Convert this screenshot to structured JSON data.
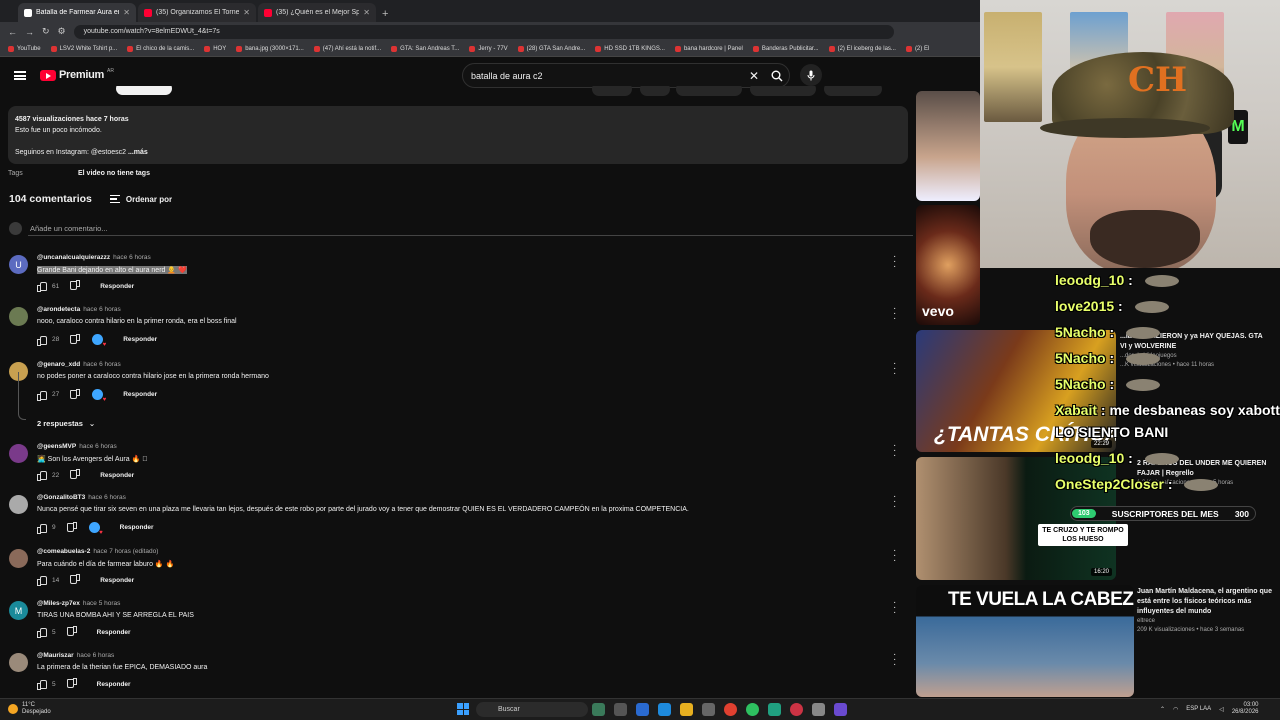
{
  "browser": {
    "tabs": [
      {
        "title": "Batalla de Farmear Aura en el..."
      },
      {
        "title": "(35) Organizamos El Torneo M..."
      },
      {
        "title": "(35) ¿Quién es el Mejor Spider..."
      }
    ],
    "url": "youtube.com/watch?v=8elmEDWUt_4&t=7s",
    "bookmarks": [
      "YouTube",
      "LSV2 White Tshirt p...",
      "El chico de la camis...",
      "HOY",
      "bana.jpg (3000×171...",
      "(47) Ahí está la notif...",
      "GTA: San Andreas T...",
      "Jerry - 77V",
      "(28) GTA San Andre...",
      "HD SSD 1TB KINGS...",
      "bana hardcore | Panel",
      "Banderas Publicitar...",
      "(2) El iceberg de las...",
      "(2) El"
    ]
  },
  "youtube": {
    "logo": "Premium",
    "logo_cc": "AR",
    "search_query": "batalla de aura c2"
  },
  "description": {
    "stats": "4587 visualizaciones  hace 7 horas",
    "line1": "Esto fue un poco incómodo.",
    "instagram": "Seguinos en Instagram: @estoesc2",
    "more": "...más"
  },
  "tags": {
    "label": "Tags",
    "value": "El video no tiene tags"
  },
  "comments": {
    "count_label": "104 comentarios",
    "sort_label": "Ordenar por",
    "add_placeholder": "Añade un comentario...",
    "reply_label": "Responder",
    "items": [
      {
        "user": "@uncanalcualquierazzz",
        "time": "hace 6 horas",
        "text": "Grande Bani dejando en alto el aura nerd 🧑‍🦲 ❤️",
        "likes": "61",
        "initial": "U",
        "color": "#5c6bc0"
      },
      {
        "user": "@arondetecta",
        "time": "hace 6 horas",
        "text": "nooo, caraloco contra hilario en la primer ronda, era el boss final",
        "likes": "28",
        "initial": "",
        "color": "#6b7a52"
      },
      {
        "user": "@genaro_xdd",
        "time": "hace 6 horas",
        "text": "no podes poner a caraloco contra hilario jose en la primera ronda hermano",
        "likes": "27",
        "initial": "",
        "color": "#c8a050"
      },
      {
        "user": "@geensMVP",
        "time": "hace 6 horas",
        "text": "🧑‍💻 Son los Avengers del Aura 🔥 🏻",
        "likes": "22",
        "initial": "",
        "color": "#7a3a8a"
      },
      {
        "user": "@GonzalitoBT3",
        "time": "hace 6 horas",
        "text": "Nunca pensé que tirar six seven en una plaza me llevaria tan lejos, después de este robo por parte del jurado voy a tener que demostrar QUIEN ES EL VERDADERO CAMPEÓN en la proxima COMPETENCIA.",
        "likes": "9",
        "initial": "",
        "color": "#aaa"
      },
      {
        "user": "@comeabuelas-2",
        "time": "hace 7 horas (editado)",
        "text": "Para cuándo el día de farmear laburo 🔥 🔥",
        "likes": "14",
        "initial": "",
        "color": "#8a6a5a"
      },
      {
        "user": "@Miles-zp7ex",
        "time": "hace 5 horas",
        "text": "TIRAS UNA BOMBA AHI Y SE ARREGLA EL PAIS",
        "likes": "5",
        "initial": "M",
        "color": "#1a8a9a"
      },
      {
        "user": "@Mauriszar",
        "time": "hace 6 horas",
        "text": "La primera de la therian fue EPICA, DEMASIADO aura",
        "likes": "5",
        "initial": "",
        "color": "#9a8a7a"
      }
    ],
    "replies_label": "2 respuestas"
  },
  "recommendations": {
    "vevo": "vevo",
    "critics_title": "¿TANTAS CRÍTICAS",
    "r3_title": "...ía NO SALIERON y ya HAY QUEJAS. GTA VI y WOLVERINE",
    "r3_channel": "...dor de Videojuegos",
    "r3_stats": "...K visualizaciones • hace 11 horas",
    "r3_duration": "22:29",
    "r4_title": "2 RAPEROS DEL UNDER ME QUIEREN FAJAR | Regrello",
    "r4_stats": "1,3 K visualizaciones • hace 5 horas",
    "r4_duration": "16:20",
    "r5_banner": "TE VUELA LA CABEZA",
    "r5_title": "Juan Martín Maldacena, el argentino que está entre los físicos teóricos más influyentes del mundo",
    "r5_channel": "eltrece",
    "r5_stats": "209 K visualizaciones • hace 3 semanas",
    "r2_duration": "3:47"
  },
  "stream": {
    "cap_logo": "CH",
    "chat": [
      {
        "user": "leoodg_10",
        "text": ""
      },
      {
        "user": "love2015",
        "text": ""
      },
      {
        "user": "5Nacho",
        "text": ""
      },
      {
        "user": "5Nacho",
        "text": ""
      },
      {
        "user": "5Nacho",
        "text": ""
      },
      {
        "user": "Xabait",
        "text": "me desbaneas soy xabott"
      },
      {
        "user": "",
        "text": "LO SIENTO BANI"
      },
      {
        "user": "leoodg_10",
        "text": ""
      },
      {
        "user": "OneStep2Closer",
        "text": ""
      }
    ],
    "subs_count": "103",
    "subs_label": "SUSCRIPTORES DEL MES",
    "subs_goal": "300",
    "sticker": "TE CRUZO Y TE ROMPO LOS HUESO"
  },
  "taskbar": {
    "temp": "11°C",
    "weather": "Despejado",
    "search": "Buscar",
    "lang": "ESP LAA",
    "time": "03:00",
    "date": "26/8/2026"
  }
}
